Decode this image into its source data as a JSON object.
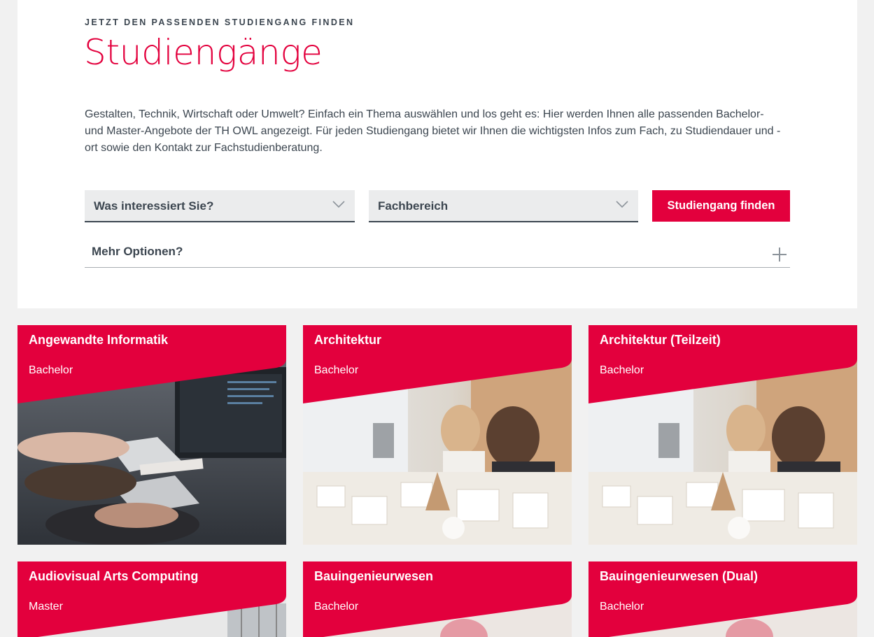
{
  "header": {
    "eyebrow": "JETZT DEN PASSENDEN STUDIENGANG FINDEN",
    "title": "Studiengänge",
    "intro": "Gestalten, Technik, Wirtschaft oder Umwelt? Einfach ein Thema auswählen und los geht es: Hier werden Ihnen alle passenden Bachelor- und Master-Angebote der TH OWL angezeigt. Für jeden Studiengang bietet wir Ihnen die wichtigsten Infos zum Fach, zu Studiendauer und -ort sowie den Kontakt zur Fachstudienberatung."
  },
  "filters": {
    "interest": "Was interessiert Sie?",
    "department": "Fachbereich",
    "submit": "Studiengang finden",
    "more_options": "Mehr Optionen?"
  },
  "colors": {
    "brand": "#e3003d",
    "text": "#3c4650",
    "background": "#f1f1f1"
  },
  "courses": [
    {
      "name": "Angewandte Informatik",
      "degree": "Bachelor",
      "image": "computer-workstation-photo"
    },
    {
      "name": "Architektur",
      "degree": "Bachelor",
      "image": "architecture-model-photo"
    },
    {
      "name": "Architektur (Teilzeit)",
      "degree": "Bachelor",
      "image": "architecture-model-photo"
    },
    {
      "name": "Audiovisual Arts Computing",
      "degree": "Master",
      "image": "studio-window-photo"
    },
    {
      "name": "Bauingenieurwesen",
      "degree": "Bachelor",
      "image": "construction-photo"
    },
    {
      "name": "Bauingenieurwesen (Dual)",
      "degree": "Bachelor",
      "image": "construction-photo"
    }
  ]
}
